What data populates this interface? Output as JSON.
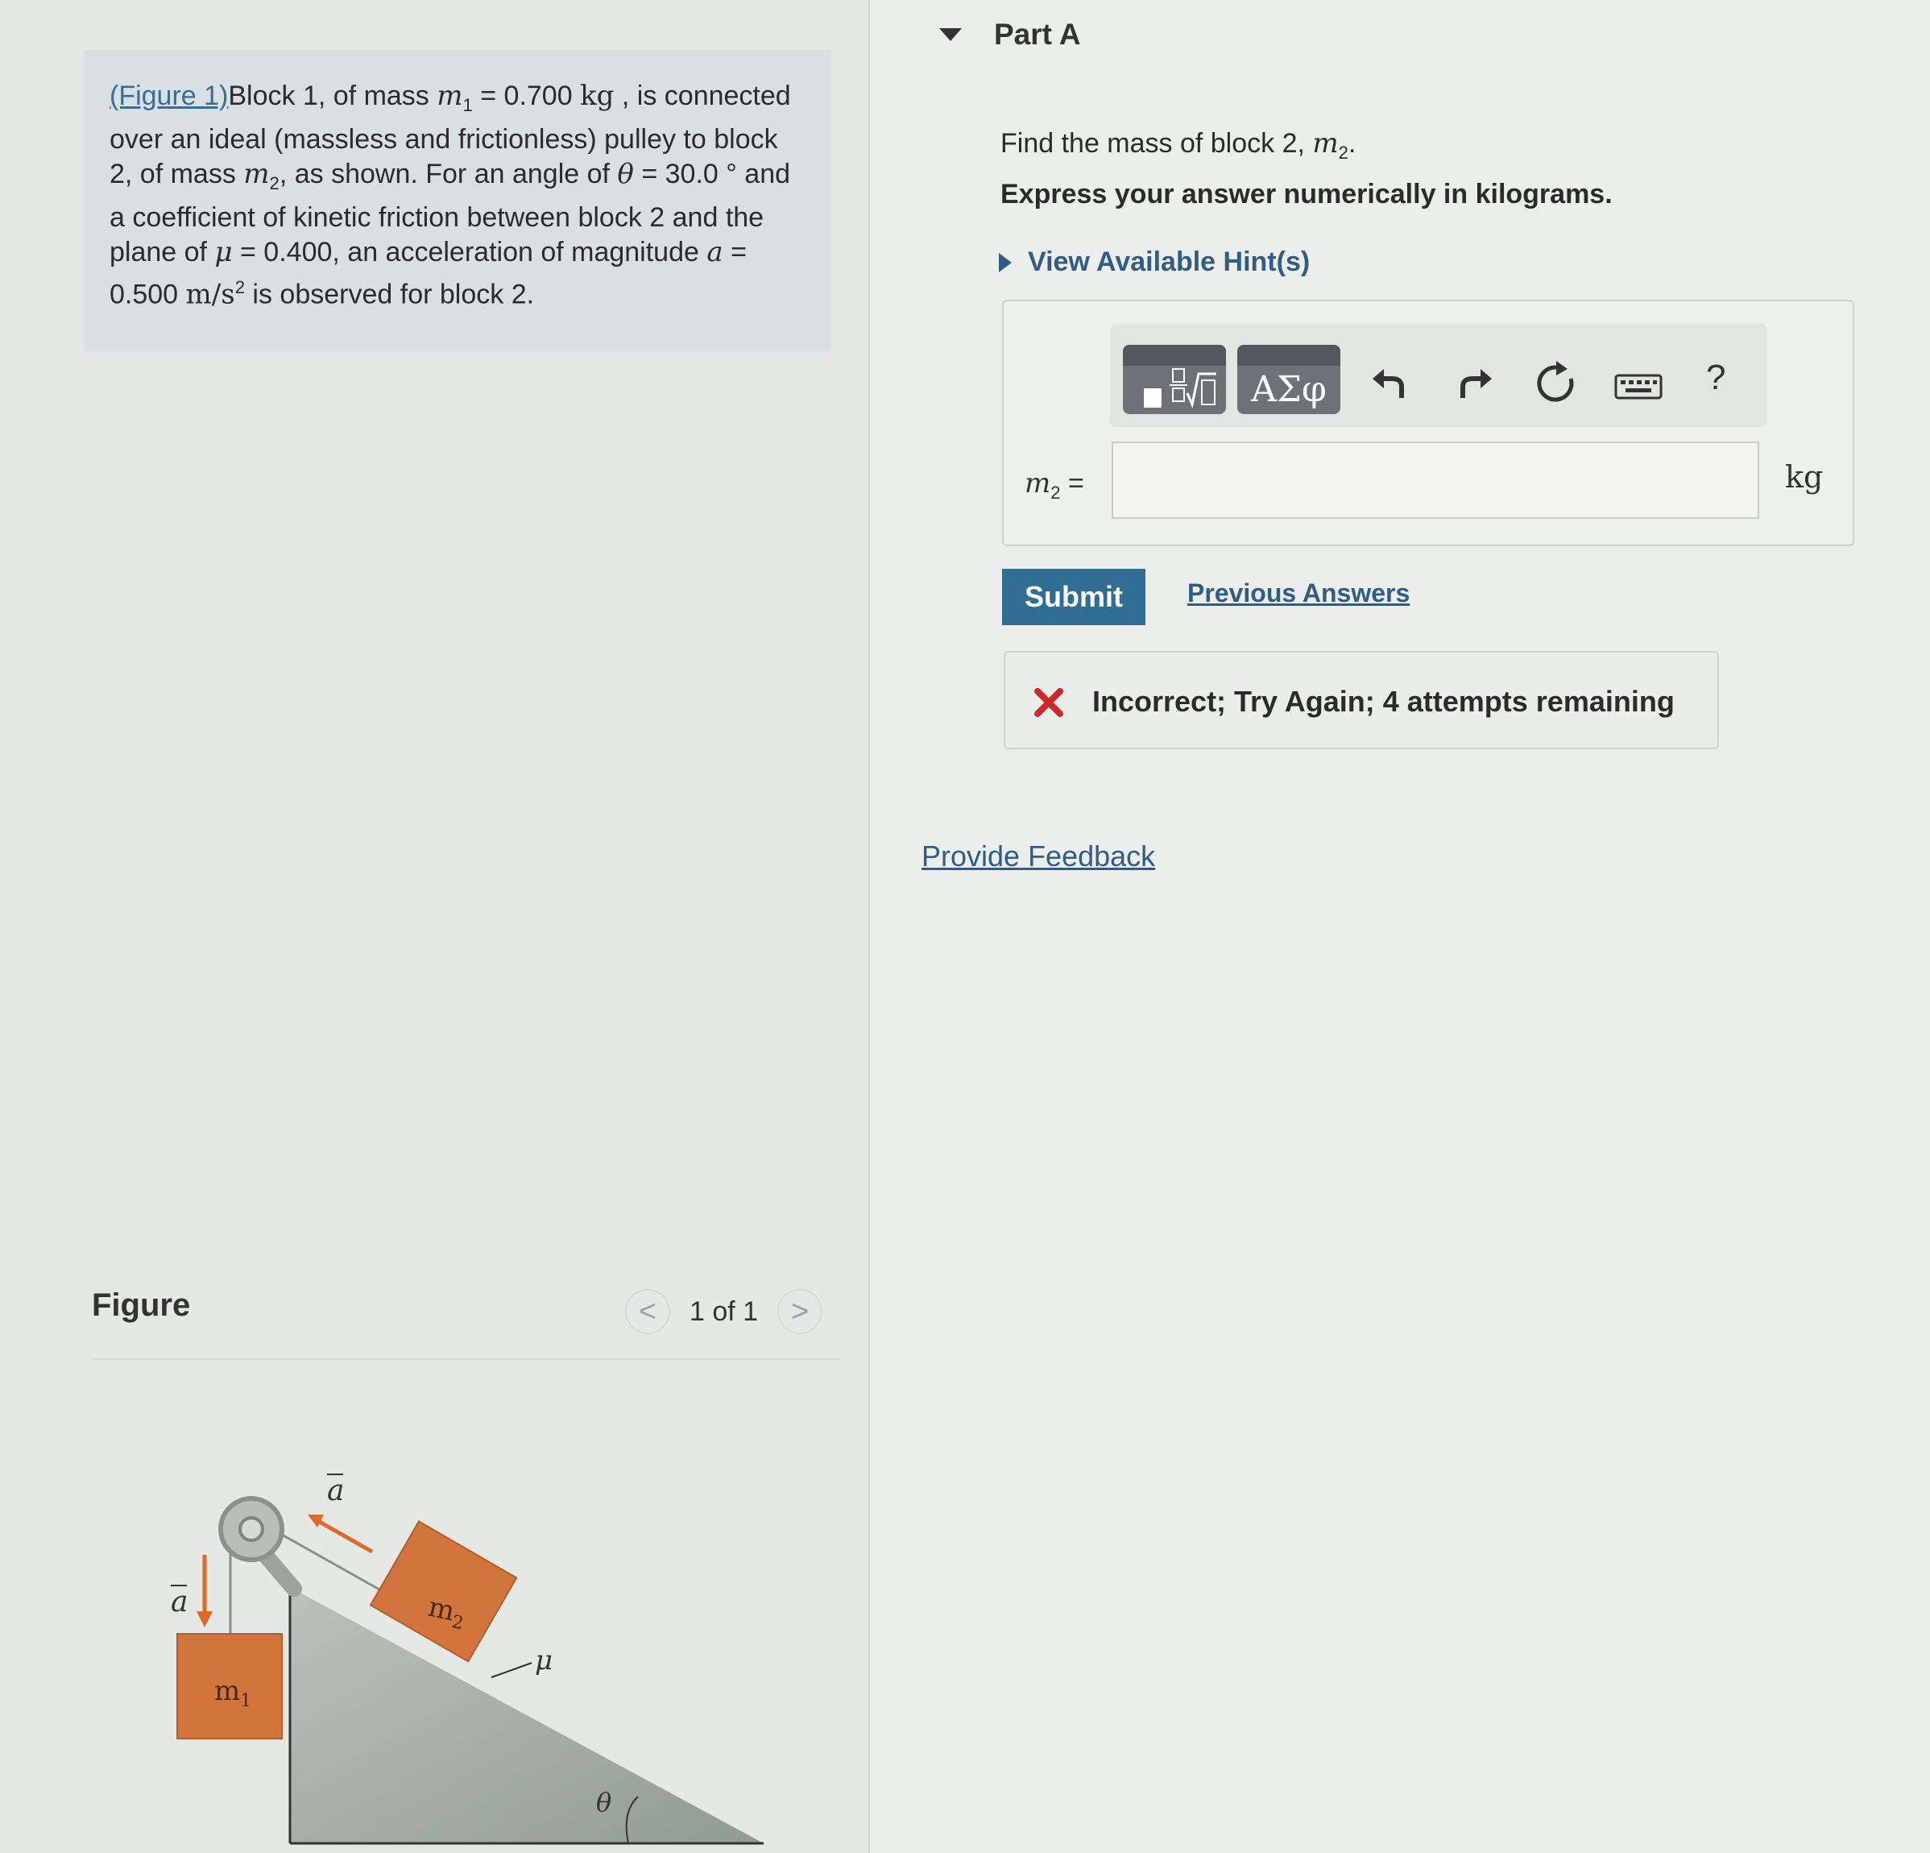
{
  "problem": {
    "figure_link": "(Figure 1)",
    "text_1": "Block 1, of mass ",
    "m1_symbol": "m",
    "m1_sub": "1",
    "m1_value": " = 0.700 ",
    "m1_unit": "kg",
    "text_2": " , is connected",
    "line_2": "over an ideal (massless and frictionless) pulley to block",
    "text_3a": "2, of mass ",
    "m2_symbol": "m",
    "m2_sub": "2",
    "text_3b": ", as shown. For an angle of ",
    "theta_symbol": "θ",
    "theta_value": " = 30.0 °",
    "text_3c": "  and",
    "line_4": "a coefficient of kinetic friction between block 2 and the",
    "text_5a": "plane of ",
    "mu_symbol": "μ",
    "mu_value": " = 0.400, an acceleration of magnitude ",
    "a_symbol": "a",
    "text_5b": " =",
    "accel_value": "0.500 ",
    "accel_unit": "m/s",
    "accel_exp": "2",
    "text_6": "  is observed for block 2."
  },
  "figure": {
    "title": "Figure",
    "pager_label": "1 of 1",
    "prev_glyph": "<",
    "next_glyph": ">",
    "label_a_left": "a",
    "label_a_top": "a",
    "label_m1": "m",
    "label_m1_sub": "1",
    "label_m2": "m",
    "label_m2_sub": "2",
    "label_mu": "μ",
    "label_theta": "θ",
    "colors": {
      "block": "#d2753d",
      "incline": "#a7b3ad",
      "arrow": "#e0682a"
    }
  },
  "part": {
    "title": "Part A",
    "question_prefix": "Find the mass of block 2, ",
    "question_symbol": "m",
    "question_sub": "2",
    "question_suffix": ".",
    "instruction": "Express your answer numerically in kilograms.",
    "hints_label": "View Available Hint(s)"
  },
  "toolbar": {
    "greek_label": "ΑΣφ",
    "help_label": "?",
    "icons": [
      "template-icon",
      "greek-icon",
      "undo-icon",
      "redo-icon",
      "reset-icon",
      "keyboard-icon",
      "help-icon"
    ]
  },
  "answer": {
    "var_symbol": "m",
    "var_sub": "2",
    "equals": " =",
    "value": "",
    "unit": "kg"
  },
  "actions": {
    "submit_label": "Submit",
    "previous_answers_label": "Previous Answers"
  },
  "feedback": {
    "message": "Incorrect; Try Again; 4 attempts remaining",
    "status_color": "#cc2a2a"
  },
  "provide_feedback_label": "Provide Feedback"
}
